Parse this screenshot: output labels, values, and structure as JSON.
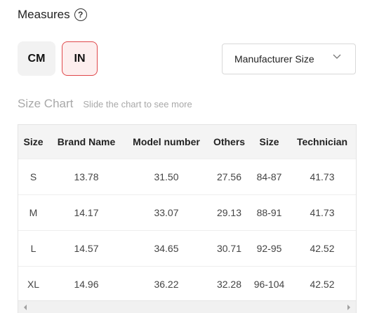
{
  "header": {
    "title": "Measures",
    "help_icon": "question-circle-icon",
    "help_glyph": "?"
  },
  "units": {
    "cm_label": "CM",
    "in_label": "IN",
    "selected": "IN",
    "accent_color": "#e0484b"
  },
  "size_select": {
    "value": "Manufacturer Size",
    "icon": "chevron-down-icon"
  },
  "size_chart": {
    "title": "Size Chart",
    "hint": "Slide the chart to see more",
    "columns": [
      "Size",
      "Brand Name",
      "Model number",
      "Others",
      "Size",
      "Technician"
    ],
    "rows": [
      [
        "S",
        "13.78",
        "31.50",
        "27.56",
        "84-87",
        "41.73"
      ],
      [
        "M",
        "14.17",
        "33.07",
        "29.13",
        "88-91",
        "41.73"
      ],
      [
        "L",
        "14.57",
        "34.65",
        "30.71",
        "92-95",
        "42.52"
      ],
      [
        "XL",
        "14.96",
        "36.22",
        "32.28",
        "96-104",
        "42.52"
      ]
    ]
  },
  "scrollbar": {
    "left_icon": "scroll-left-arrow-icon",
    "right_icon": "scroll-right-arrow-icon"
  }
}
